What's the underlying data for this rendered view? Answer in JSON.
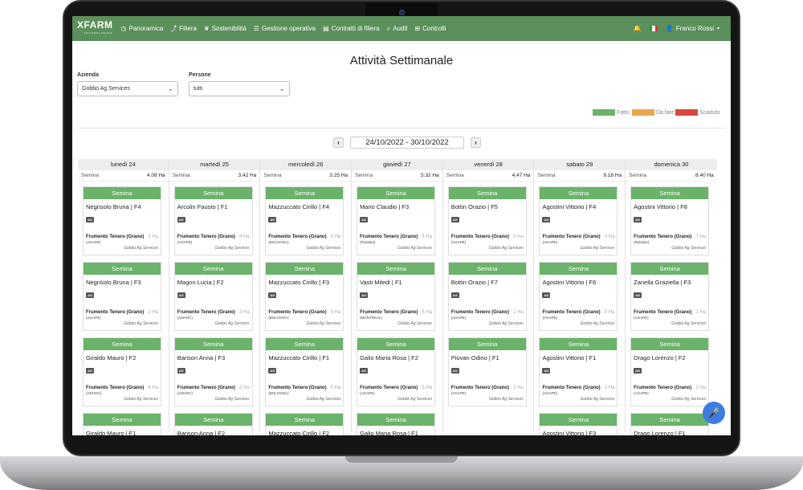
{
  "nav": {
    "logo": "XFARM",
    "logo_sub": "TECHNOLOGIES",
    "items": [
      {
        "label": "Panoramica",
        "icon": "dashboard-icon",
        "glyph": "◷"
      },
      {
        "label": "Filiera",
        "icon": "chart-icon",
        "glyph": "⤴"
      },
      {
        "label": "Sostenibilità",
        "icon": "leaf-icon",
        "glyph": "❦"
      },
      {
        "label": "Gestione operativa",
        "icon": "list-icon",
        "glyph": "☰"
      },
      {
        "label": "Contratti di filiera",
        "icon": "document-icon",
        "glyph": "▤"
      },
      {
        "label": "Audit",
        "icon": "search-icon",
        "glyph": "⌕"
      },
      {
        "label": "Controlli",
        "icon": "grid-icon",
        "glyph": "⊞"
      }
    ],
    "user": "Franco Rossi"
  },
  "page": {
    "title": "Attività Settimanale",
    "azienda_label": "Azienda",
    "azienda_value": "Gobbo Ag Services",
    "persone_label": "Persone",
    "persone_value": "tutti"
  },
  "legend": [
    {
      "label": "Fatto",
      "color": "#6bb36b"
    },
    {
      "label": "Da fare",
      "color": "#e8a74e"
    },
    {
      "label": "Scaduto",
      "color": "#d9473c"
    }
  ],
  "week": {
    "range": "24/10/2022 - 30/10/2022",
    "prev": "‹",
    "next": "›"
  },
  "days": [
    {
      "name": "lunedì 24",
      "summary_label": "Semina",
      "summary_value": "4.08 Ha",
      "cards": [
        {
          "header": "Semina",
          "person": "Negrisolo Bruna | F4",
          "tag": "AG",
          "crop": "Frumento Tenero (Grano)",
          "ha": "2 Ha",
          "variety": "(AGAPE)",
          "company": "Gobbo Ag Services"
        },
        {
          "header": "Semina",
          "person": "Negrisolo Bruna | F3",
          "tag": "AG",
          "crop": "Frumento Tenero (Grano)",
          "ha": "2 Ha",
          "variety": "(AGAPE)",
          "company": "Gobbo Ag Services"
        },
        {
          "header": "Semina",
          "person": "Giraldo Mauro | F2",
          "tag": "AG",
          "crop": "Frumento Tenero (Grano)",
          "ha": "9 Ha",
          "variety": "(ADHOC)",
          "company": "Gobbo Ag Services"
        },
        {
          "header": "Semina",
          "person": "Giraldo Mauro | F1",
          "tag": "",
          "crop": "",
          "ha": "",
          "variety": "",
          "company": ""
        }
      ]
    },
    {
      "name": "martedì 25",
      "summary_label": "Semina",
      "summary_value": "3.42 Ha",
      "cards": [
        {
          "header": "Semina",
          "person": "Arcolin Fausto | F1",
          "tag": "AG",
          "crop": "Frumento Tenero (Grano)",
          "ha": "4 Ha",
          "variety": "(AGAPE)",
          "company": "Gobbo Ag Services"
        },
        {
          "header": "Semina",
          "person": "Magon Lucia | F2",
          "tag": "AG",
          "crop": "Frumento Tenero (Grano)",
          "ha": "2 Ha",
          "variety": "(ADHOC)",
          "company": "Gobbo Ag Services"
        },
        {
          "header": "Semina",
          "person": "Barison Anna | F3",
          "tag": "AG",
          "crop": "Frumento Tenero (Grano)",
          "ha": "2 Ha",
          "variety": "(ADHOC)",
          "company": "Gobbo Ag Services"
        },
        {
          "header": "Semina",
          "person": "Barison Anna | F2",
          "tag": "",
          "crop": "",
          "ha": "",
          "variety": "",
          "company": ""
        }
      ]
    },
    {
      "name": "mercoledì 26",
      "summary_label": "Semina",
      "summary_value": "3.25 Ha",
      "cards": [
        {
          "header": "Semina",
          "person": "Mazzuccato Cirillo | F4",
          "tag": "AG",
          "crop": "Frumento Tenero (Grano)",
          "ha": "5 Ha",
          "variety": "(BOLOGNA)",
          "company": "Gobbo Ag Services"
        },
        {
          "header": "Semina",
          "person": "Mazzuccato Cirillo | F3",
          "tag": "AG",
          "crop": "Frumento Tenero (Grano)",
          "ha": "5 Ha",
          "variety": "(BOLOGNA)",
          "company": "Gobbo Ag Services"
        },
        {
          "header": "Semina",
          "person": "Mazzuccato Cirillo | F1",
          "tag": "AG",
          "crop": "Frumento Tenero (Grano)",
          "ha": "5 Ha",
          "variety": "(BOLOGNA)",
          "company": "Gobbo Ag Services"
        },
        {
          "header": "Semina",
          "person": "Mazzuccato Cirillo | F2",
          "tag": "",
          "crop": "",
          "ha": "",
          "variety": "",
          "company": ""
        }
      ]
    },
    {
      "name": "giovedì 27",
      "summary_label": "Semina",
      "summary_value": "5.32 Ha",
      "cards": [
        {
          "header": "Semina",
          "person": "Mario Claudio | F3",
          "tag": "AG",
          "crop": "Frumento Tenero (Grano)",
          "ha": "5 Ha",
          "variety": "(Rubisko)",
          "company": "Gobbo Ag Services"
        },
        {
          "header": "Semina",
          "person": "Vasti Miledi | F1",
          "tag": "AG",
          "crop": "Frumento Tenero (Grano)",
          "ha": "5 Ha",
          "variety": "(MONTREAL)",
          "company": "Gobbo Ag Services"
        },
        {
          "header": "Semina",
          "person": "Galio Maria Rosa | F2",
          "tag": "AG",
          "crop": "Frumento Tenero (Grano)",
          "ha": "5 Ha",
          "variety": "(AGAPE)",
          "company": "Gobbo Ag Services"
        },
        {
          "header": "Semina",
          "person": "Galio Maria Rosa | F1",
          "tag": "",
          "crop": "",
          "ha": "",
          "variety": "",
          "company": ""
        }
      ]
    },
    {
      "name": "venerdì 28",
      "summary_label": "Semina",
      "summary_value": "4.47 Ha",
      "cards": [
        {
          "header": "Semina",
          "person": "Bottin Orazio | F5",
          "tag": "AG",
          "crop": "Frumento Tenero (Grano)",
          "ha": "0 Ha",
          "variety": "(AGAPE)",
          "company": "Gobbo Ag Services"
        },
        {
          "header": "Semina",
          "person": "Bottin Orazio | F7",
          "tag": "AG",
          "crop": "Frumento Tenero (Grano)",
          "ha": "1 Ha",
          "variety": "(AGAPE)",
          "company": "Gobbo Ag Services"
        },
        {
          "header": "Semina",
          "person": "Piovan Odino | F1",
          "tag": "AG",
          "crop": "Frumento Tenero (Grano)",
          "ha": "2 Ha",
          "variety": "(AGAPE)",
          "company": "Gobbo Ag Services"
        }
      ]
    },
    {
      "name": "sabato 29",
      "summary_label": "Semina",
      "summary_value": "9.18 Ha",
      "cards": [
        {
          "header": "Semina",
          "person": "Agostini Vittorio | F4",
          "tag": "AG",
          "crop": "Frumento Tenero (Grano)",
          "ha": "0 Ha",
          "variety": "(AGAPE)",
          "company": "Gobbo Ag Services"
        },
        {
          "header": "Semina",
          "person": "Agostini Vittorio | F6",
          "tag": "AG",
          "crop": "Frumento Tenero (Grano)",
          "ha": "9 Ha",
          "variety": "(AGAPE)",
          "company": "Gobbo Ag Services"
        },
        {
          "header": "Semina",
          "person": "Agostini Vittorio | F1",
          "tag": "AG",
          "crop": "Frumento Tenero (Grano)",
          "ha": "2 Ha",
          "variety": "(AGAPE)",
          "company": "Gobbo Ag Services"
        },
        {
          "header": "Semina",
          "person": "Agostini Vittorio | F3",
          "tag": "",
          "crop": "",
          "ha": "",
          "variety": "",
          "company": ""
        }
      ]
    },
    {
      "name": "domenica 30",
      "summary_label": "Semina",
      "summary_value": "8.40 Ha",
      "cards": [
        {
          "header": "Semina",
          "person": "Agostini Vittorio | F8",
          "tag": "AG",
          "crop": "Frumento Tenero (Grano)",
          "ha": "7 Ha",
          "variety": "(Rubisko)",
          "company": "Gobbo Ag Services"
        },
        {
          "header": "Semina",
          "person": "Zanella Graziella | F3",
          "tag": "AG",
          "crop": "Frumento Tenero (Grano)",
          "ha": "1 Ha",
          "variety": "(AGAPE)",
          "company": "Gobbo Ag Services"
        },
        {
          "header": "Semina",
          "person": "Drago Lorenzo | F2",
          "tag": "AG",
          "crop": "Frumento Tenero (Grano)",
          "ha": "2 Ha",
          "variety": "(AGAPE)",
          "company": "Gobbo Ag Services"
        },
        {
          "header": "Semina",
          "person": "Drago Lorenzo | F1",
          "tag": "",
          "crop": "",
          "ha": "",
          "variety": "",
          "company": ""
        }
      ]
    }
  ]
}
